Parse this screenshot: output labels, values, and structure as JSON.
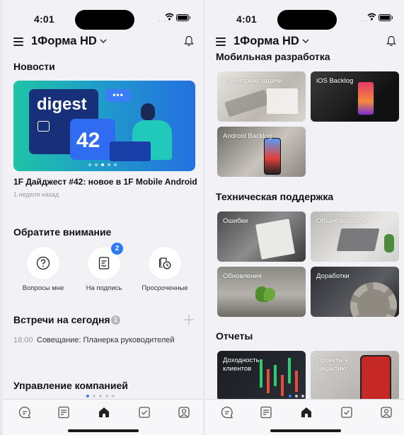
{
  "status_bar": {
    "time": "4:01"
  },
  "header": {
    "title": "1Форма HD"
  },
  "left": {
    "news_heading": "Новости",
    "banner": {
      "word": "digest",
      "number": "42",
      "bubble": "•••"
    },
    "news_item": {
      "title": "1F Дайджест #42: новое в 1F Mobile Android",
      "subtitle": "1 неделя назад"
    },
    "attention_heading": "Обратите внимание",
    "actions": [
      {
        "label": "Вопросы мне",
        "icon": "question-icon"
      },
      {
        "label": "На подпись",
        "icon": "document-sign-icon",
        "badge": "2"
      },
      {
        "label": "Просроченные",
        "icon": "overdue-clock-icon"
      }
    ],
    "meetings_heading": "Встречи на сегодня",
    "meetings_count": "1",
    "meeting": {
      "time": "18:00",
      "text": "Совещание: Планерка руководителей"
    },
    "company_heading": "Управление компанией"
  },
  "right": {
    "sections": [
      {
        "title": "Мобильная разработка",
        "tiles": [
          {
            "label": "Клиентские задачи"
          },
          {
            "label": "iOS Backlog"
          },
          {
            "label": "Android Backlog"
          }
        ]
      },
      {
        "title": "Техническая поддержка",
        "tiles": [
          {
            "label": "Ошибки"
          },
          {
            "label": "Общие вопросы"
          },
          {
            "label": "Обновления"
          },
          {
            "label": "Доработки"
          }
        ]
      },
      {
        "title": "Отчеты",
        "tiles": [
          {
            "label": "Доходность клиентов"
          },
          {
            "label": "Проекты к закрытию"
          }
        ]
      }
    ]
  },
  "tabbar": {
    "tabs": [
      {
        "icon": "chat-icon",
        "active": false
      },
      {
        "icon": "tasks-list-icon",
        "active": false
      },
      {
        "icon": "home-icon",
        "active": true
      },
      {
        "icon": "checkbox-icon",
        "active": false
      },
      {
        "icon": "profile-icon",
        "active": false
      }
    ]
  },
  "colors": {
    "accent": "#2a7bf5",
    "background": "#f2f2f6"
  }
}
